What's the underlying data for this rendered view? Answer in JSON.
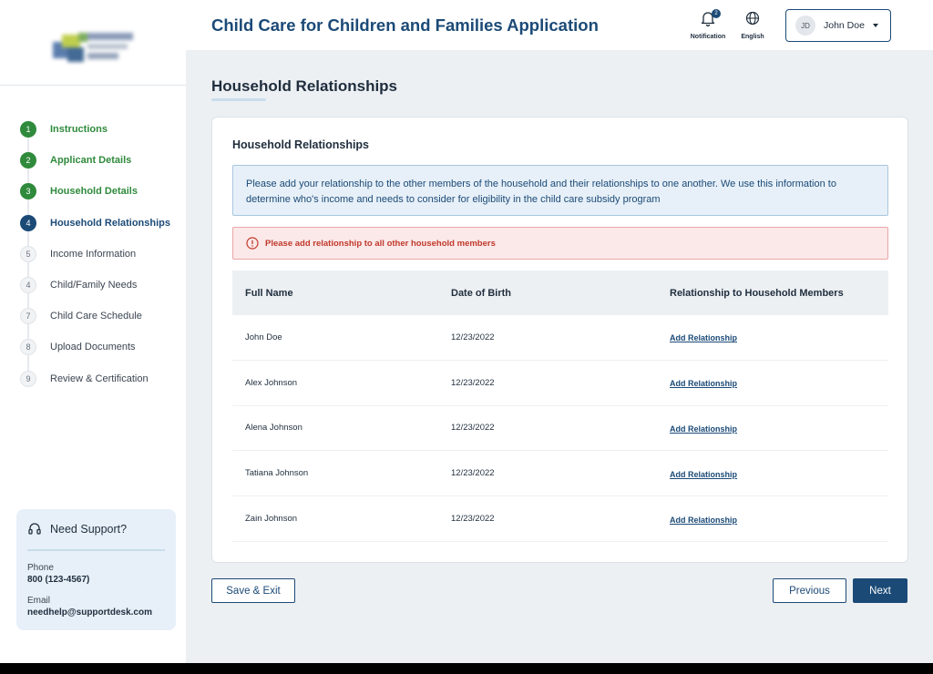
{
  "header": {
    "app_title": "Child Care for Children and Families Application",
    "notification_label": "Notification",
    "notification_count": "2",
    "language_label": "English",
    "user_initials": "JD",
    "user_name": "John Doe"
  },
  "sidebar": {
    "steps": [
      {
        "number": "1",
        "label": "Instructions",
        "state": "done"
      },
      {
        "number": "2",
        "label": "Applicant Details",
        "state": "done"
      },
      {
        "number": "3",
        "label": "Household Details",
        "state": "done"
      },
      {
        "number": "4",
        "label": "Household Relationships",
        "state": "current"
      },
      {
        "number": "5",
        "label": "Income Information",
        "state": "todo"
      },
      {
        "number": "4",
        "label": "Child/Family Needs",
        "state": "todo"
      },
      {
        "number": "7",
        "label": "Child Care Schedule",
        "state": "todo"
      },
      {
        "number": "8",
        "label": "Upload Documents",
        "state": "todo"
      },
      {
        "number": "9",
        "label": "Review & Certification",
        "state": "todo"
      }
    ],
    "support": {
      "title": "Need Support?",
      "phone_label": "Phone",
      "phone_value": "800 (123-4567)",
      "email_label": "Email",
      "email_value": "needhelp@supportdesk.com"
    }
  },
  "main": {
    "page_title": "Household Relationships",
    "card_title": "Household Relationships",
    "info_text": "Please add your relationship to the other members of the household and their relationships to one another. We use this information to determine who's income and needs to consider for eligibility in the child care subsidy program",
    "error_text": "Please add relationship to all other household members",
    "table": {
      "headers": [
        "Full Name",
        "Date of Birth",
        "Relationship to Household Members"
      ],
      "rows": [
        {
          "name": "John Doe",
          "dob": "12/23/2022",
          "action": "Add Relationship"
        },
        {
          "name": "Alex Johnson",
          "dob": "12/23/2022",
          "action": "Add Relationship"
        },
        {
          "name": "Alena Johnson",
          "dob": "12/23/2022",
          "action": "Add Relationship"
        },
        {
          "name": "Tatiana Johnson",
          "dob": "12/23/2022",
          "action": "Add Relationship"
        },
        {
          "name": "Zain Johnson",
          "dob": "12/23/2022",
          "action": "Add Relationship"
        }
      ]
    }
  },
  "footer": {
    "save_exit_label": "Save & Exit",
    "previous_label": "Previous",
    "next_label": "Next"
  },
  "colors": {
    "primary": "#1b4a77",
    "success": "#2f8a3c",
    "error": "#c0392b",
    "info_bg": "#e7f0f8",
    "page_bg": "#edf0f3"
  }
}
